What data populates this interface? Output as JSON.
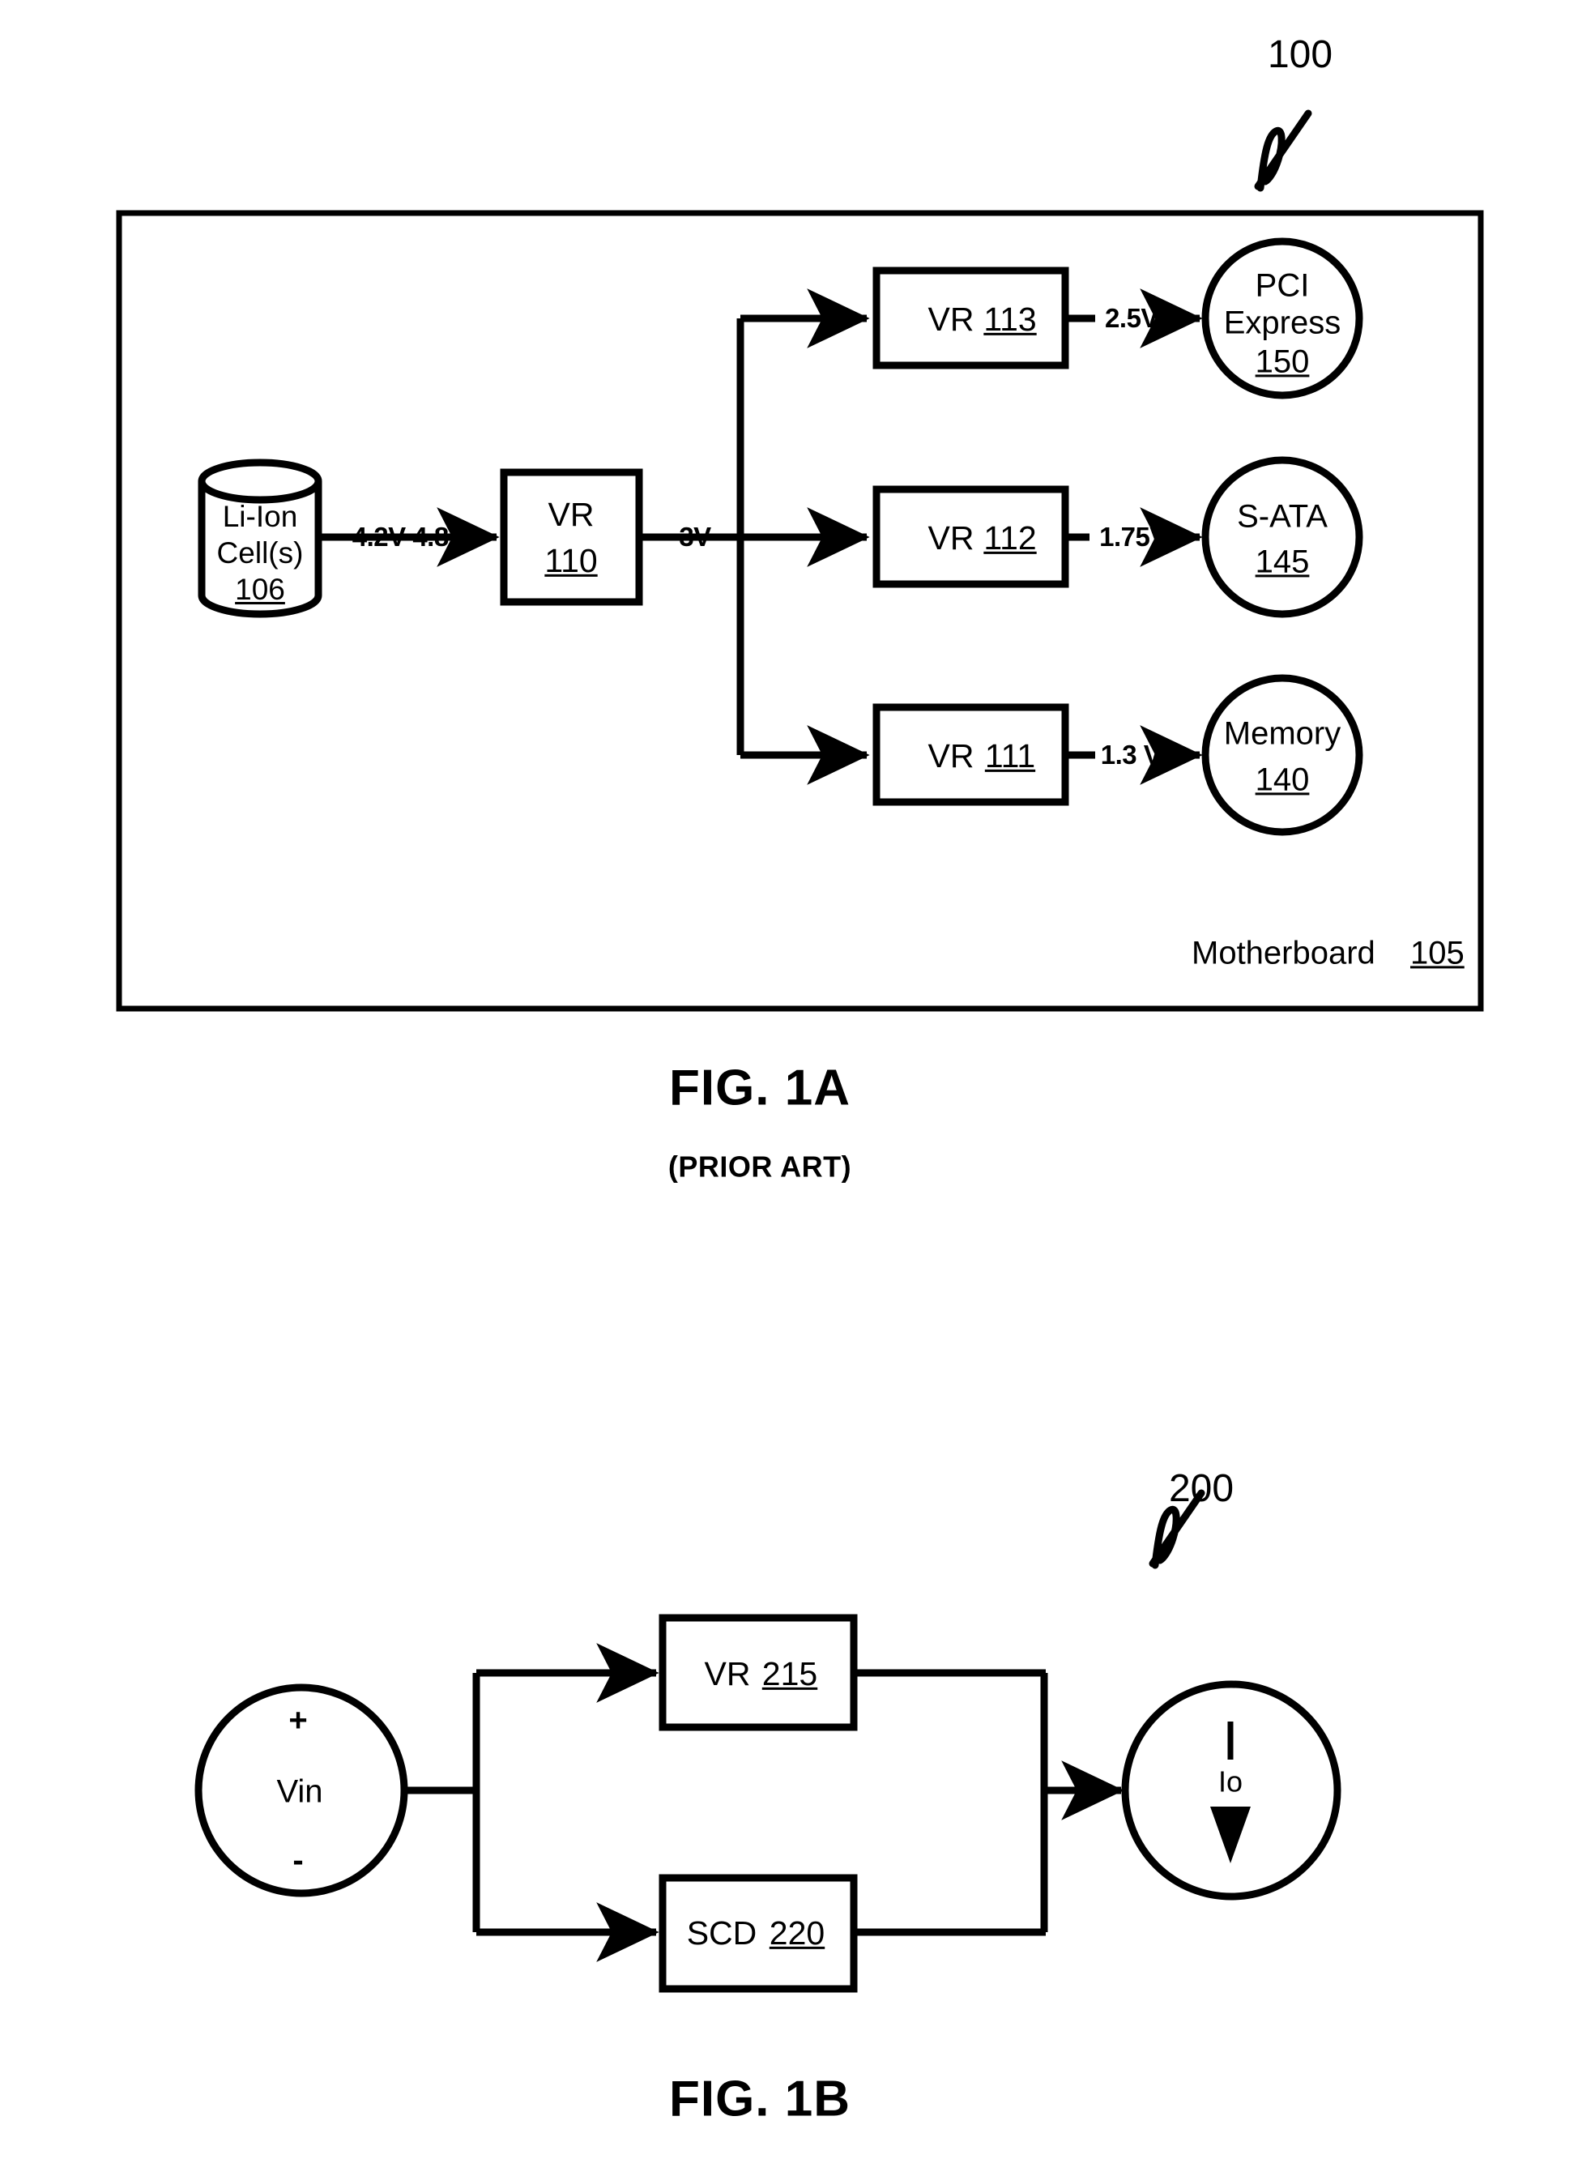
{
  "page": {
    "background": "#ffffff",
    "ink": "#000000"
  },
  "figures": [
    {
      "id": "fig-1a",
      "caption": "FIG. 1A",
      "subcaption": "(PRIOR ART)",
      "ref_number": "100",
      "container": {
        "name": "Motherboard",
        "ref": "105",
        "label_text": "Motherboard",
        "label_ref": "105"
      },
      "source": {
        "line1": "Li-Ion",
        "line2": "Cell(s)",
        "ref": "106"
      },
      "main_regulator": {
        "label": "VR",
        "ref": "110"
      },
      "edges": {
        "battery_to_vr110": "4.2V-4.8V",
        "vr110_out": "3V"
      },
      "branches": [
        {
          "regulator_label": "VR",
          "regulator_ref": "113",
          "voltage": "2.5V",
          "load_line1": "PCI",
          "load_line2": "Express",
          "load_ref": "150"
        },
        {
          "regulator_label": "VR",
          "regulator_ref": "112",
          "voltage": "1.75V",
          "load_line1": "S-ATA",
          "load_line2": "",
          "load_ref": "145"
        },
        {
          "regulator_label": "VR",
          "regulator_ref": "111",
          "voltage": "1.3 V",
          "load_line1": "Memory",
          "load_line2": "",
          "load_ref": "140"
        }
      ]
    },
    {
      "id": "fig-1b",
      "caption": "FIG. 1B",
      "ref_number": "200",
      "source": {
        "label": "Vin",
        "plus": "+",
        "minus": "-"
      },
      "blocks": [
        {
          "label": "VR",
          "ref": "215"
        },
        {
          "label": "SCD",
          "ref": "220"
        }
      ],
      "output": {
        "label": "Io"
      }
    }
  ]
}
